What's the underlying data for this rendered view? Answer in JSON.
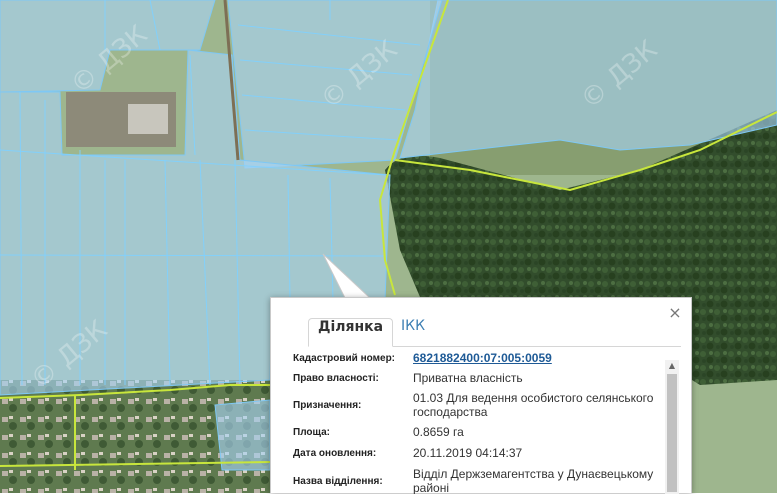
{
  "map": {
    "watermark": "© ДЗК",
    "colors": {
      "parcel_fill": "#a8d4f5",
      "parcel_stroke": "#7ec8f5",
      "boundary": "#c8e63c",
      "forest": "#2f4a2a",
      "field": "#8fa872"
    }
  },
  "popup": {
    "close_label": "×",
    "tabs": [
      {
        "label": "Ділянка",
        "active": true
      },
      {
        "label": "ІКК",
        "active": false
      }
    ],
    "fields": [
      {
        "label": "Кадастровий номер:",
        "value": "6821882400:07:005:0059",
        "link": true
      },
      {
        "label": "Право власності:",
        "value": "Приватна власність"
      },
      {
        "label": "Призначення:",
        "value": "01.03 Для ведення особистого селянського господарства"
      },
      {
        "label": "Площа:",
        "value": "0.8659 га"
      },
      {
        "label": "Дата оновлення:",
        "value": "20.11.2019 04:14:37"
      },
      {
        "label": "Назва відділення:",
        "value": "Відділ Держземагентства у Дунаєвецькому районі"
      }
    ]
  }
}
